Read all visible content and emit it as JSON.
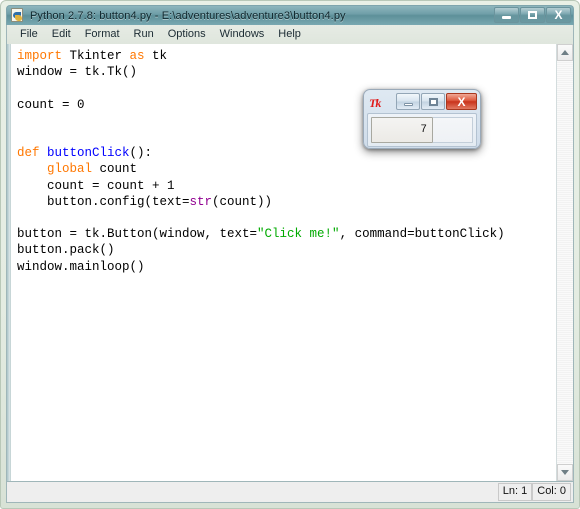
{
  "window": {
    "title": "Python 2.7.8: button4.py - E:\\adventures\\adventure3\\button4.py",
    "icon": "python-file-icon",
    "controls": {
      "minimize": "minimize-icon",
      "maximize": "maximize-icon",
      "close": "X"
    }
  },
  "menu": {
    "items": [
      {
        "label": "File"
      },
      {
        "label": "Edit"
      },
      {
        "label": "Format"
      },
      {
        "label": "Run"
      },
      {
        "label": "Options"
      },
      {
        "label": "Windows"
      },
      {
        "label": "Help"
      }
    ]
  },
  "editor": {
    "code_lines": [
      "import Tkinter as tk",
      "window = tk.Tk()",
      "",
      "count = 0",
      "",
      "",
      "def buttonClick():",
      "    global count",
      "    count = count + 1",
      "    button.config(text=str(count))",
      "",
      "button = tk.Button(window, text=\"Click me!\", command=buttonClick)",
      "button.pack()",
      "window.mainloop()"
    ],
    "colors": {
      "keyword": "#ff7700",
      "function": "#0000ff",
      "string": "#00aa00",
      "builtin": "#900090",
      "text": "#000000",
      "background": "#ffffff"
    }
  },
  "scrollbar": {
    "up_arrow": "scroll-up-icon",
    "down_arrow": "scroll-down-icon"
  },
  "status_bar": {
    "line": "Ln: 1",
    "column": "Col: 0"
  },
  "tk_popup": {
    "logo": "Tk",
    "controls": {
      "minimize": "minimize-icon",
      "maximize": "maximize-icon",
      "close": "X"
    },
    "button_label": "7"
  }
}
